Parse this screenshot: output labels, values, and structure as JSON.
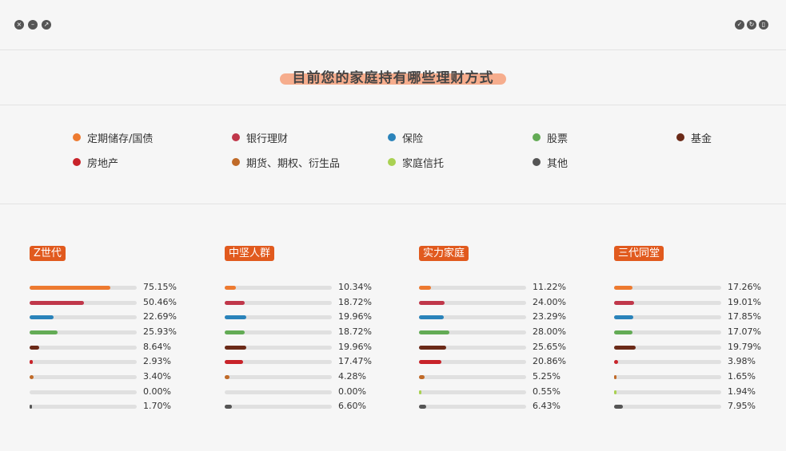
{
  "title": "目前您的家庭持有哪些理财方式",
  "window_icons": [
    "close-icon",
    "minimize-icon",
    "restore-icon",
    "check-icon",
    "refresh-icon",
    "trash-icon"
  ],
  "legend": [
    {
      "label": "定期储存/国债",
      "color": "#ed7a30"
    },
    {
      "label": "银行理财",
      "color": "#c0374a"
    },
    {
      "label": "保险",
      "color": "#2a83ba"
    },
    {
      "label": "股票",
      "color": "#63ab55"
    },
    {
      "label": "基金",
      "color": "#6b2a18"
    },
    {
      "label": "房地产",
      "color": "#c8232a"
    },
    {
      "label": "期货、期权、衍生品",
      "color": "#c06a28"
    },
    {
      "label": "家庭信托",
      "color": "#a9d152"
    },
    {
      "label": "其他",
      "color": "#555555"
    }
  ],
  "chart_data": {
    "type": "bar",
    "orientation": "horizontal",
    "categories": [
      "定期储存/国债",
      "银行理财",
      "保险",
      "股票",
      "基金",
      "房地产",
      "期货、期权、衍生品",
      "家庭信托",
      "其他"
    ],
    "xlim": [
      0,
      100
    ],
    "series": [
      {
        "name": "Z世代",
        "values": [
          75.15,
          50.46,
          22.69,
          25.93,
          8.64,
          2.93,
          3.4,
          0.0,
          1.7
        ],
        "labels": [
          "75.15%",
          "50.46%",
          "22.69%",
          "25.93%",
          "8.64%",
          "2.93%",
          "3.40%",
          "0.00%",
          "1.70%"
        ]
      },
      {
        "name": "中坚人群",
        "values": [
          10.34,
          18.72,
          19.96,
          18.72,
          19.96,
          17.47,
          4.28,
          0.0,
          6.6
        ],
        "labels": [
          "10.34%",
          "18.72%",
          "19.96%",
          "18.72%",
          "19.96%",
          "17.47%",
          "4.28%",
          "0.00%",
          "6.60%"
        ]
      },
      {
        "name": "实力家庭",
        "values": [
          11.22,
          24.0,
          23.29,
          28.0,
          25.65,
          20.86,
          5.25,
          0.55,
          6.43
        ],
        "labels": [
          "11.22%",
          "24.00%",
          "23.29%",
          "28.00%",
          "25.65%",
          "20.86%",
          "5.25%",
          "0.55%",
          "6.43%"
        ]
      },
      {
        "name": "三代同堂",
        "values": [
          17.26,
          19.01,
          17.85,
          17.07,
          19.79,
          3.98,
          1.65,
          1.94,
          7.95
        ],
        "labels": [
          "17.26%",
          "19.01%",
          "17.85%",
          "17.07%",
          "19.79%",
          "3.98%",
          "1.65%",
          "1.94%",
          "7.95%"
        ]
      }
    ]
  }
}
